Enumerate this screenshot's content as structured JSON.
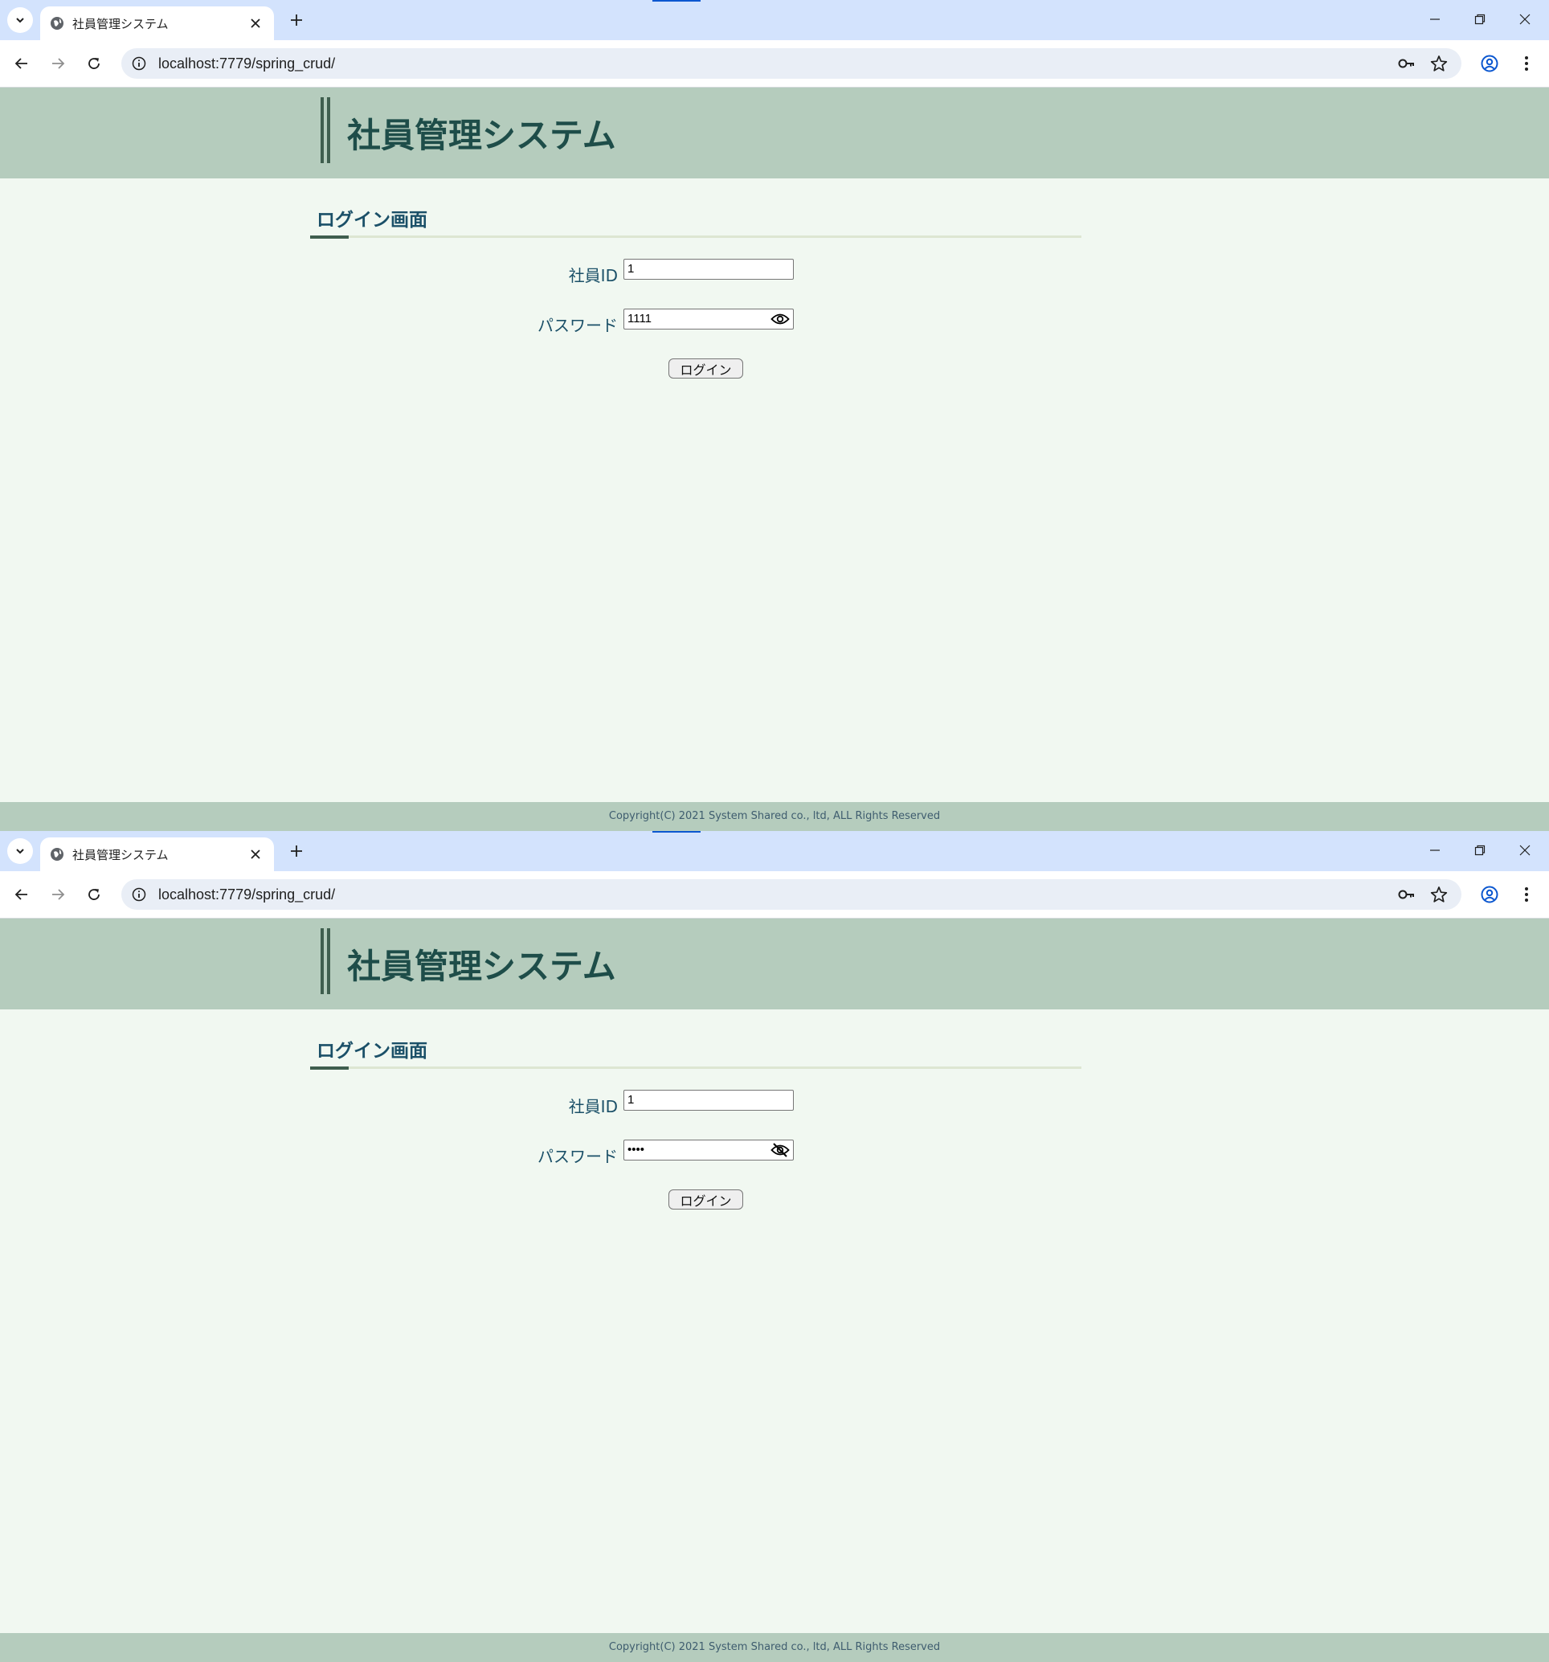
{
  "screenshots": [
    {
      "browser": {
        "tab_title": "社員管理システム",
        "url": "localhost:7779/spring_crud/"
      },
      "page": {
        "header_title": "社員管理システム",
        "section_title": "ログイン画面",
        "form": {
          "employee_id_label": "社員ID",
          "employee_id_value": "1",
          "password_label": "パスワード",
          "password_display": "1111",
          "password_visible": true,
          "login_button_label": "ログイン"
        },
        "footer": "Copyright(C) 2021 System Shared co., ltd, ALL Rights Reserved"
      }
    },
    {
      "browser": {
        "tab_title": "社員管理システム",
        "url": "localhost:7779/spring_crud/"
      },
      "page": {
        "header_title": "社員管理システム",
        "section_title": "ログイン画面",
        "form": {
          "employee_id_label": "社員ID",
          "employee_id_value": "1",
          "password_label": "パスワード",
          "password_display": "••••",
          "password_visible": false,
          "login_button_label": "ログイン"
        },
        "footer": "Copyright(C) 2021 System Shared co., ltd, ALL Rights Reserved"
      }
    }
  ],
  "icons": {
    "tab_list": "chevron-down-icon",
    "favicon": "globe-icon",
    "tab_close": "close-icon",
    "new_tab": "plus-icon",
    "back": "arrow-left-icon",
    "forward": "arrow-right-icon",
    "reload": "reload-icon",
    "site_info": "info-icon",
    "password_manager": "key-icon",
    "bookmark": "star-icon",
    "profile": "profile-icon",
    "menu": "kebab-menu-icon"
  },
  "colors": {
    "chrome_tabstrip": "#d3e3fd",
    "header_bg": "#b5ccbd",
    "page_bg": "#f1f8f1",
    "title_color": "#1e4d49",
    "label_color": "#1b5068"
  }
}
